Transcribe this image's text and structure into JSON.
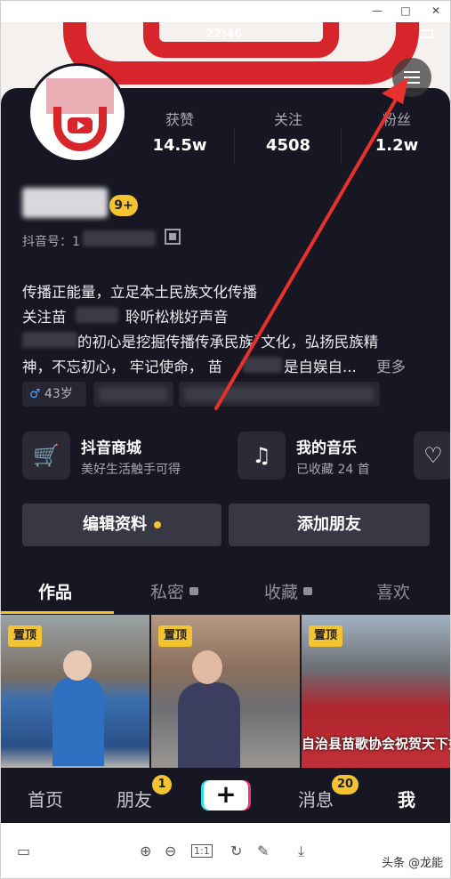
{
  "statusbar": {
    "time": "22:46"
  },
  "profile": {
    "stats": [
      {
        "label": "获赞",
        "value": "14.5w"
      },
      {
        "label": "关注",
        "value": "4508"
      },
      {
        "label": "粉丝",
        "value": "1.2w"
      }
    ],
    "level_badge": "9+",
    "id_prefix": "抖音号：1",
    "bio_lines": [
      "传播正能量，立足本土民族文化传播",
      "关注苗",
      "聆听松桃好声音",
      "的初心是挖掘传播传承民族`文化，弘扬民族精",
      "神，不忘初心，  牢记使命，  苗",
      "是自娱自...",
      "更多"
    ],
    "age_tag": "43岁"
  },
  "cards": [
    {
      "title": "抖音商城",
      "subtitle": "美好生活触手可得",
      "icon": "cart-icon"
    },
    {
      "title": "我的音乐",
      "subtitle": "已收藏 24 首",
      "icon": "music-icon"
    }
  ],
  "buttons": {
    "edit": "编辑资料",
    "add_friend": "添加朋友"
  },
  "tabs": [
    {
      "label": "作品"
    },
    {
      "label": "私密"
    },
    {
      "label": "收藏"
    },
    {
      "label": "喜欢"
    }
  ],
  "thumbnails": [
    {
      "pin": "置顶"
    },
    {
      "pin": "置顶"
    },
    {
      "pin": "置顶",
      "caption": "自治县苗歌协会祝贺天下如"
    }
  ],
  "bottom_nav": {
    "home": "首页",
    "friends": "朋友",
    "friends_badge": "1",
    "plus": "+",
    "messages": "消息",
    "messages_badge": "20",
    "me": "我"
  },
  "watermark": "头条 @龙能",
  "colors": {
    "accent": "#f4c430",
    "panel": "#161722",
    "arrow": "#e8302c"
  }
}
